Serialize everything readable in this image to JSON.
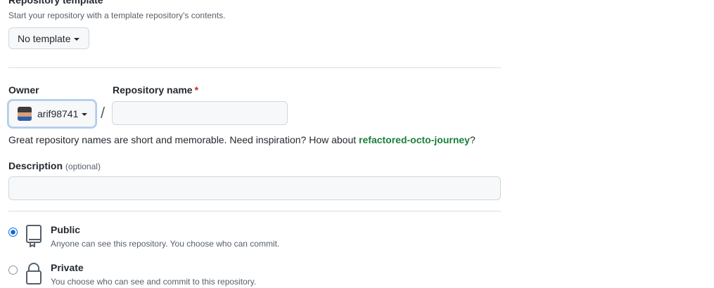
{
  "template": {
    "title": "Repository template",
    "subtitle": "Start your repository with a template repository's contents.",
    "selected": "No template"
  },
  "owner": {
    "label": "Owner",
    "value": "arif98741"
  },
  "repo_name": {
    "label": "Repository name",
    "required_mark": "*",
    "value": "",
    "placeholder": ""
  },
  "name_hint": {
    "prefix": "Great repository names are short and memorable. Need inspiration? How about ",
    "suggestion": "refactored-octo-journey",
    "suffix": "?"
  },
  "description": {
    "label": "Description",
    "optional": "(optional)",
    "value": ""
  },
  "visibility": {
    "public": {
      "title": "Public",
      "desc": "Anyone can see this repository. You choose who can commit.",
      "selected": true
    },
    "private": {
      "title": "Private",
      "desc": "You choose who can see and commit to this repository.",
      "selected": false
    }
  },
  "colors": {
    "accent": "#0969da",
    "suggestion": "#1a7f37",
    "required": "#cf222e"
  }
}
